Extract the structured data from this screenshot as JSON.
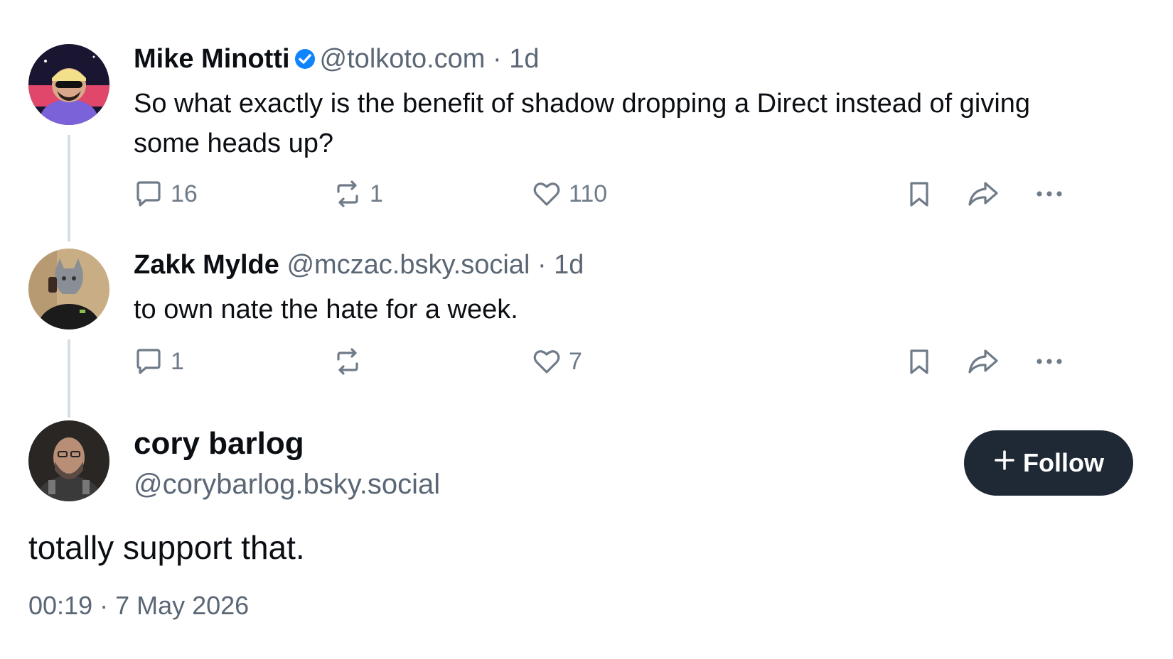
{
  "post1": {
    "name": "Mike Minotti",
    "verified": true,
    "handle": "@tolkoto.com",
    "separator": "·",
    "time": "1d",
    "text": "So what exactly is the benefit of shadow dropping a Direct instead of giving some heads up?",
    "reply_count": "16",
    "repost_count": "1",
    "like_count": "110"
  },
  "post2": {
    "name": "Zakk Mylde",
    "handle": "@mczac.bsky.social",
    "separator": "·",
    "time": "1d",
    "text": "to own nate the hate for a week.",
    "reply_count": "1",
    "repost_count": "",
    "like_count": "7"
  },
  "post3": {
    "name": "cory barlog",
    "handle": "@corybarlog.bsky.social",
    "follow_label": "Follow",
    "follow_icon": "+",
    "text": "totally support that.",
    "timestamp": "00:19 · 7 May 2026"
  },
  "colors": {
    "accent_blue": "#1083fe",
    "button_dark": "#1e2935",
    "muted_text": "#5b6775",
    "icon_gray": "#6f7b88",
    "thread_line": "#d6dde5"
  },
  "icons": [
    "reply-icon",
    "repost-icon",
    "like-icon",
    "bookmark-icon",
    "share-icon",
    "more-icon",
    "verified-icon",
    "plus-icon"
  ]
}
